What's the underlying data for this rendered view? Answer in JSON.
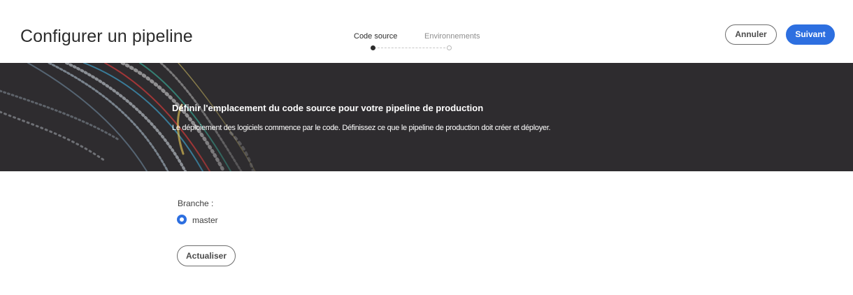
{
  "header": {
    "title": "Configurer un pipeline",
    "cancel_label": "Annuler",
    "next_label": "Suivant"
  },
  "stepper": {
    "steps": [
      {
        "label": "Code source",
        "state": "done"
      },
      {
        "label": "Environnements",
        "state": "todo"
      }
    ]
  },
  "banner": {
    "title": "Définir l'emplacement du code source pour votre pipeline de production",
    "subtitle": "Le déploiement des logiciels commence par le code. Définissez ce que le pipeline de production doit créer et déployer."
  },
  "form": {
    "branch_label": "Branche :",
    "branch_options": [
      {
        "label": "master",
        "selected": true
      }
    ],
    "refresh_label": "Actualiser"
  },
  "colors": {
    "accent": "#2d6fe0",
    "banner_bg": "#2e2c2f",
    "text": "#2c2c2c"
  }
}
